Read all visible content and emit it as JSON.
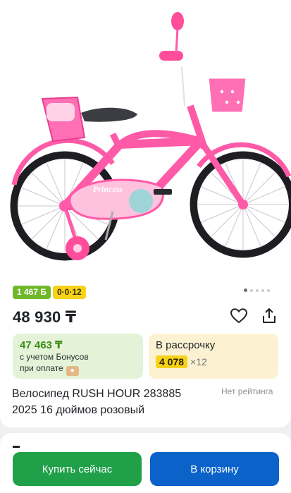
{
  "product": {
    "badges": {
      "bonus": "1 467 Б",
      "installment": "0·0·12"
    },
    "gallery": {
      "image_count": 5,
      "active_index": 0,
      "image_label": "Princess"
    },
    "price": "48 930 ₸",
    "bonus_panel": {
      "amount": "47 463 ₸",
      "line1": "с учетом Бонусов",
      "line2": "при оплате"
    },
    "credit_panel": {
      "title": "В рассрочку",
      "amount": "4 078",
      "term": "×12"
    },
    "title": "Велосипед RUSH HOUR 283885 2025 16 дюймов розовый",
    "rating": "Нет рейтинга"
  },
  "actions": {
    "buy_now": "Купить сейчас",
    "add_to_cart": "В корзину"
  },
  "colors": {
    "bonus_badge": "#6fb82a",
    "installment_badge": "#f7d21a",
    "buy_button": "#1fa049",
    "cart_button": "#0b63c9",
    "bike_pink": "#ff5aa8"
  },
  "icons": [
    "heart-icon",
    "share-icon",
    "wallet-icon"
  ]
}
